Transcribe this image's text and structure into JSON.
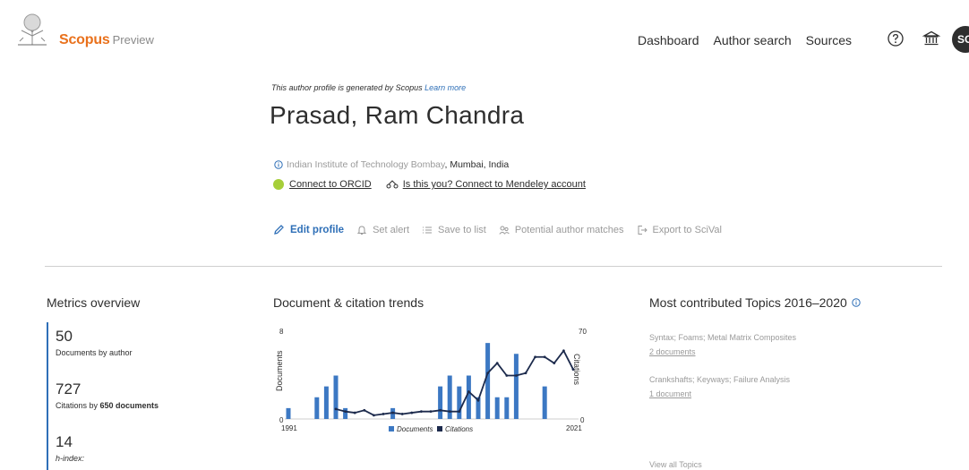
{
  "header": {
    "brand_name": "Scopus",
    "brand_suffix": "Preview",
    "nav": [
      "Dashboard",
      "Author search",
      "Sources"
    ],
    "help_icon": "help-circle-icon",
    "institution_icon": "institution-icon",
    "avatar_initials": "SC"
  },
  "profile": {
    "generated_note": "This author profile is generated by Scopus",
    "learn_more": "Learn more",
    "name": "Prasad, Ram Chandra",
    "affiliation_institution": "Indian Institute of Technology Bombay",
    "affiliation_location": ", Mumbai, India",
    "orcid_link": "Connect to ORCID",
    "mendeley_link": "Is this you? Connect to Mendeley account"
  },
  "actions": {
    "edit_profile": "Edit profile",
    "set_alert": "Set alert",
    "save_to_list": "Save to list",
    "potential_matches": "Potential author matches",
    "export_scival": "Export to SciVal"
  },
  "metrics": {
    "title": "Metrics overview",
    "documents_count": "50",
    "documents_label": "Documents by author",
    "citations_count": "727",
    "citations_label_prefix": "Citations by ",
    "citations_label_bold": "650 documents",
    "h_index": "14",
    "h_index_label": "h-index:"
  },
  "chart": {
    "title": "Document & citation trends",
    "legend_documents": "Documents",
    "legend_citations": "Citations"
  },
  "chart_data": {
    "type": "bar",
    "x": [
      1991,
      1992,
      1993,
      1994,
      1995,
      1996,
      1997,
      1998,
      1999,
      2000,
      2001,
      2002,
      2003,
      2004,
      2005,
      2006,
      2007,
      2008,
      2009,
      2010,
      2011,
      2012,
      2013,
      2014,
      2015,
      2016,
      2017,
      2018,
      2019,
      2020,
      2021
    ],
    "series": [
      {
        "name": "Documents",
        "values": [
          1,
          0,
          0,
          2,
          3,
          4,
          1,
          0,
          0,
          0,
          0,
          1,
          0,
          0,
          0,
          0,
          3,
          4,
          3,
          4,
          2,
          7,
          2,
          2,
          6,
          0,
          0,
          3,
          0,
          0,
          0
        ]
      },
      {
        "name": "Citations",
        "values": [
          null,
          null,
          null,
          null,
          null,
          8,
          6,
          5,
          7,
          3,
          4,
          5,
          4,
          5,
          6,
          6,
          7,
          6,
          6,
          22,
          15,
          37,
          45,
          35,
          35,
          37,
          50,
          50,
          45,
          55,
          40
        ]
      }
    ],
    "xlabel": "",
    "ylabel": "Documents",
    "y2label": "Citations",
    "ylim": [
      0,
      8
    ],
    "y2lim": [
      0,
      70
    ],
    "xtick_labels": [
      "1991",
      "2021"
    ],
    "ytick_labels": [
      "0",
      "8"
    ],
    "y2tick_labels": [
      "0",
      "70"
    ],
    "colors": {
      "Documents": "#3c78c3",
      "Citations": "#1c2a4c"
    },
    "legend": "bottom"
  },
  "topics": {
    "title": "Most contributed Topics 2016–2020",
    "items": [
      {
        "name": "Syntax; Foams; Metal Matrix Composites",
        "docs": "2 documents"
      },
      {
        "name": "Crankshafts; Keyways; Failure Analysis",
        "docs": "1 document"
      }
    ],
    "view_all": "View all Topics"
  }
}
